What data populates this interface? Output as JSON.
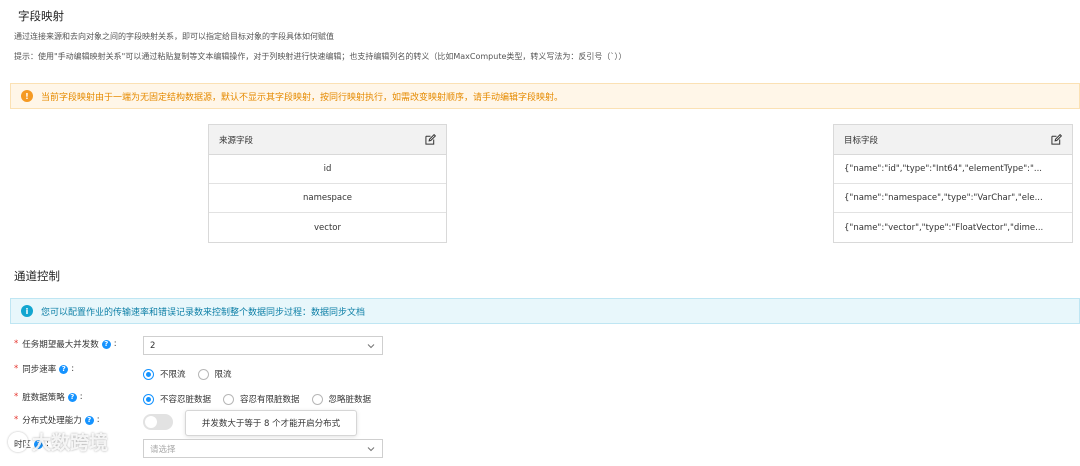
{
  "field_mapping": {
    "title": "字段映射",
    "desc1": "通过连接来源和去向对象之间的字段映射关系，即可以指定给目标对象的字段具体如何赋值",
    "desc2": "提示：使用\"手动编辑映射关系\"可以通过粘贴复制等文本编辑操作，对于列映射进行快速编辑；也支持编辑列名的转义（比如MaxCompute类型，转义写法为：反引号（`））",
    "warning": "当前字段映射由于一端为无固定结构数据源，默认不显示其字段映射，按同行映射执行，如需改变映射顺序，请手动编辑字段映射。",
    "source": {
      "header": "来源字段",
      "rows": [
        "id",
        "namespace",
        "vector"
      ]
    },
    "target": {
      "header": "目标字段",
      "rows": [
        "{\"name\":\"id\",\"type\":\"Int64\",\"elementType\":\"...",
        "{\"name\":\"namespace\",\"type\":\"VarChar\",\"ele...",
        "{\"name\":\"vector\",\"type\":\"FloatVector\",\"dime..."
      ]
    },
    "icons": {
      "edit": "edit-icon",
      "warning": "warning-icon"
    }
  },
  "channel_control": {
    "title": "通道控制",
    "info": "您可以配置作业的传输速率和错误记录数来控制整个数据同步过程：数据同步文档",
    "max_concurrency": {
      "label": "任务期望最大并发数",
      "value": "2"
    },
    "sync_rate": {
      "label": "同步速率",
      "options": [
        "不限流",
        "限流"
      ],
      "selected": 0
    },
    "dirty_data": {
      "label": "脏数据策略",
      "options": [
        "不容忍脏数据",
        "容忍有限脏数据",
        "忽略脏数据"
      ],
      "selected": 0
    },
    "distributed": {
      "label": "分布式处理能力",
      "enabled": false,
      "tooltip": "并发数大于等于 8 个才能开启分布式"
    },
    "timezone": {
      "label": "时区",
      "placeholder": "请选择"
    }
  },
  "watermark": {
    "text": "大数跨境"
  },
  "colors": {
    "accent": "#1593ff",
    "warning": "#f59a23",
    "info": "#12a6d0",
    "required": "#e5342d"
  }
}
